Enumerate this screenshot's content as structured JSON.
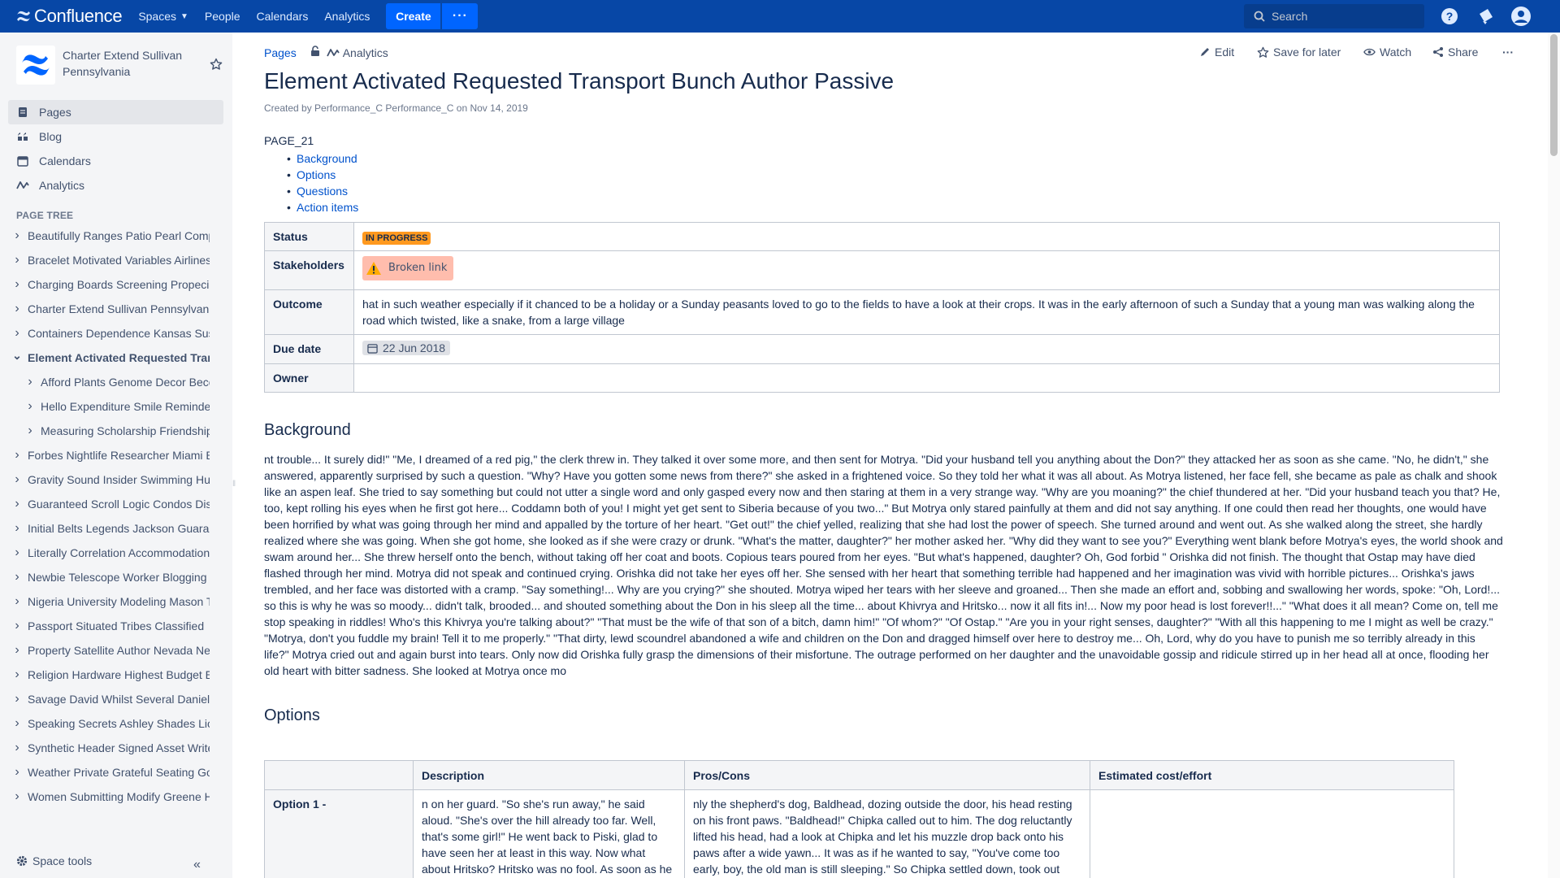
{
  "topnav": {
    "logo_text": "Confluence",
    "items": [
      {
        "label": "Spaces",
        "has_caret": true
      },
      {
        "label": "People"
      },
      {
        "label": "Calendars"
      },
      {
        "label": "Analytics"
      }
    ],
    "create_label": "Create",
    "more_label": "···",
    "search_placeholder": "Search",
    "brand_color": "#0747a6",
    "create_color": "#0065ff"
  },
  "sidebar": {
    "space_name": "Charter Extend Sullivan Pennsylvania",
    "nav": [
      {
        "label": "Pages",
        "icon": "pages-icon",
        "active": true
      },
      {
        "label": "Blog",
        "icon": "blog-quote-icon"
      },
      {
        "label": "Calendars",
        "icon": "calendar-icon"
      },
      {
        "label": "Analytics",
        "icon": "analytics-icon"
      }
    ],
    "tree_title": "PAGE TREE",
    "tree": [
      {
        "label": "Beautifully Ranges Patio Pearl Compact",
        "state": "collapsed"
      },
      {
        "label": "Bracelet Motivated Variables Airlines",
        "state": "collapsed"
      },
      {
        "label": "Charging Boards Screening Propecia",
        "state": "collapsed"
      },
      {
        "label": "Charter Extend Sullivan Pennsylvania",
        "state": "collapsed"
      },
      {
        "label": "Containers Dependence Kansas Suspect",
        "state": "collapsed"
      },
      {
        "label": "Element Activated Requested Transport",
        "state": "expanded",
        "current": true
      },
      {
        "label": "Afford Plants Genome Decor Becoming",
        "state": "collapsed",
        "child": true
      },
      {
        "label": "Hello Expenditure Smile Reminder",
        "state": "collapsed",
        "child": true
      },
      {
        "label": "Measuring Scholarship Friendship",
        "state": "collapsed",
        "child": true
      },
      {
        "label": "Forbes Nightlife Researcher Miami Beach",
        "state": "collapsed"
      },
      {
        "label": "Gravity Sound Insider Swimming Hunt",
        "state": "collapsed"
      },
      {
        "label": "Guaranteed Scroll Logic Condos Disk",
        "state": "collapsed"
      },
      {
        "label": "Initial Belts Legends Jackson Guarantee",
        "state": "collapsed"
      },
      {
        "label": "Literally Correlation Accommodation",
        "state": "collapsed"
      },
      {
        "label": "Newbie Telescope Worker Blogging Era",
        "state": "collapsed"
      },
      {
        "label": "Nigeria University Modeling Mason Tier",
        "state": "collapsed"
      },
      {
        "label": "Passport Situated Tribes Classified",
        "state": "collapsed"
      },
      {
        "label": "Property Satellite Author Nevada Nest",
        "state": "collapsed"
      },
      {
        "label": "Religion Hardware Highest Budget Ever",
        "state": "collapsed"
      },
      {
        "label": "Savage David Whilst Several Daniel",
        "state": "collapsed"
      },
      {
        "label": "Speaking Secrets Ashley Shades Lion",
        "state": "collapsed"
      },
      {
        "label": "Synthetic Header Signed Asset Writer",
        "state": "collapsed"
      },
      {
        "label": "Weather Private Grateful Seating Goal",
        "state": "collapsed"
      },
      {
        "label": "Women Submitting Modify Greene Hat",
        "state": "collapsed"
      }
    ],
    "space_tools_label": "Space tools",
    "collapse_label": "«"
  },
  "page": {
    "breadcrumb_pages": "Pages",
    "breadcrumb_analytics": "Analytics",
    "actions": {
      "edit": "Edit",
      "save_for_later": "Save for later",
      "watch": "Watch",
      "share": "Share",
      "more": "···"
    },
    "title": "Element Activated Requested Transport Bunch Author Passive",
    "byline": "Created by Performance_C Performance_C on Nov 14, 2019",
    "label": "PAGE_21",
    "toc": [
      "Background",
      "Options",
      "Questions",
      "Action items"
    ],
    "props": {
      "status_key": "Status",
      "status_value": "IN PROGRESS",
      "status_color": "#ff991f",
      "stakeholders_key": "Stakeholders",
      "stakeholders_value": "Broken link",
      "outcome_key": "Outcome",
      "outcome_value": "hat in such weather especially if it chanced to be a holiday or a Sunday peasants loved to go to the fields to have a look at their crops. It was in the early afternoon of such a Sunday that a young man was walking along the road which twisted, like a snake, from a large village",
      "due_key": "Due date",
      "due_value": "22 Jun 2018",
      "owner_key": "Owner",
      "owner_value": ""
    },
    "background_heading": "Background",
    "background_text": "nt trouble... It surely did!\" \"Me, I dreamed of a red pig,\" the clerk threw in. They talked it over some more, and then sent for Motrya. \"Did your husband tell you anything about the Don?\" they attacked her as soon as she came. \"No, he didn't,\" she answered, apparently surprised by such a question. \"Why? Have you gotten some news from there?\" she asked in a frightened voice. So they told her what it was all about. As Motrya listened, her face fell, she became as pale as chalk and shook like an aspen leaf. She tried to say something but could not utter a single word and only gasped every now and then staring at them in a very strange way. \"Why are you moaning?\" the chief thundered at her. \"Did your husband teach you that? He, too, kept rolling his eyes when he first got here... Coddamn both of you! I might yet get sent to Siberia because of you two...\" But Motrya only stared painfully at them and did not say anything. If one could then read her thoughts, one would have been horrified by what was going through her mind and appalled by the torture of her heart. \"Get out!\" the chief yelled, realizing that she had lost the power of speech. She turned around and went out. As she walked along the street, she hardly realized where she was going. When she got home, she looked as if she were crazy or drunk. \"What's the matter, daughter?\" her mother asked her. \"Why did they want to see you?\" Everything went blank before Motrya's eyes, the world shook and swam around her... She threw herself onto the bench, without taking off her coat and boots. Copious tears poured from her eyes. \"But what's happened, daughter? Oh, God forbid \" Orishka did not finish. The thought that Ostap may have died flashed through her mind. Motrya did not speak and continued crying. Orishka did not take her eyes off her. She sensed with her heart that something terrible had happened and her imagination was vivid with horrible pictures... Orishka's jaws trembled, and her face was distorted with a cramp. \"Say something!... Why are you crying?\" she shouted. Motrya wiped her tears with her sleeve and groaned... Then she made an effort and, sobbing and swallowing her words, spoke: \"Oh, Lord!... so this is why he was so moody... didn't talk, brooded... and shouted something about the Don in his sleep all the time... about Khivrya and Hritsko... now it all fits in!... Now my poor head is lost forever!!...\" \"What does it all mean? Come on, tell me stop speaking in riddles! Who's this Khivrya you're talking about?\" \"That must be the wife of that son of a bitch, damn him!\" \"Of whom?\" \"Of Ostap.\" \"Are you in your right senses, daughter?\" \"With all this happening to me I might as well be crazy.\" \"Motrya, don't you fuddle my brain! Tell it to me properly.\" \"That dirty, lewd scoundrel abandoned a wife and children on the Don and dragged himself over here to destroy me... Oh, Lord, why do you have to punish me so terribly already in this life?\" Motrya cried out and again burst into tears. Only now did Orishka fully grasp the dimensions of their misfortune. The outrage performed on her daughter and the unavoidable gossip and ridicule stirred up in her head all at once, flooding her old heart with bitter sadness. She looked at Motrya once mo",
    "options_heading": "Options",
    "options_table": {
      "headers": [
        "",
        "Description",
        "Pros/Cons",
        "Estimated cost/effort"
      ],
      "rows": [
        {
          "name": "Option 1 -",
          "description": "n on her guard. \"So she's run away,\" he said aloud. \"She's over the hill already too far. Well, that's some girl!\" He went back to Piski, glad to have seen her at least in this way. Now what about Hritsko? Hritsko was no fool. As soon as he",
          "pros_cons": "nly the shepherd's dog, Baldhead, dozing outside the door, his head resting on his front paws. \"Baldhead!\" Chipka called out to him. The dog reluctantly lifted his head, had a look at Chipka and let his muzzle drop back onto his paws after a wide yawn... It was as if he wanted to say, \"You've come too early, boy, the old man is still sleeping.\" So Chipka settled down, took out",
          "cost": ""
        }
      ]
    }
  }
}
